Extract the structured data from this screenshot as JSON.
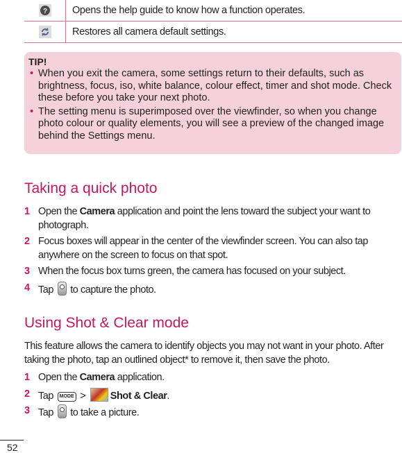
{
  "icon_table": [
    {
      "icon": "help-icon",
      "glyph": "?",
      "text": "Opens the help guide to know how a function operates."
    },
    {
      "icon": "reset-icon",
      "glyph": "⟳",
      "text": "Restores all camera default settings."
    }
  ],
  "tip": {
    "title": "TIP!",
    "bullet": "•",
    "items": [
      "When you exit the camera, some settings return to their defaults, such as brightness, focus, iso, white balance, colour effect, timer and shot mode. Check these before you take your next photo.",
      "The setting menu is superimposed over the viewfinder, so when you change photo colour or quality elements, you will see a preview of the changed image behind the Settings menu."
    ]
  },
  "quick_photo": {
    "heading": "Taking a quick photo",
    "steps": [
      {
        "num": "1",
        "pre": "Open the ",
        "bold": "Camera",
        "post": " application and point the lens toward the subject your want to photograph."
      },
      {
        "num": "2",
        "text": "Focus boxes will appear in the center of the viewfinder screen. You can also tap anywhere on the screen to focus on that spot."
      },
      {
        "num": "3",
        "text": "When the focus box turns green, the camera has focused on your subject."
      },
      {
        "num": "4",
        "pre": "Tap ",
        "icon": "shutter-icon",
        "post": " to capture the photo."
      }
    ]
  },
  "shot_clear": {
    "heading": "Using Shot & Clear mode",
    "intro": "This feature allows the camera to identify objects you may not want in your photo. After taking the photo, tap an outlined object* to remove it, then save the photo.",
    "steps": [
      {
        "num": "1",
        "pre": "Open the ",
        "bold": "Camera",
        "post": " application."
      },
      {
        "num": "2",
        "pre": "Tap ",
        "mode_label": "MODE",
        "sep": " > ",
        "bold": "Shot & Clear",
        "post": "."
      },
      {
        "num": "3",
        "pre": "Tap ",
        "icon": "shutter-icon",
        "post": " to take a picture."
      }
    ]
  },
  "page_number": "52",
  "colors": {
    "accent": "#c8175d",
    "tip_bg": "#f5d1db",
    "rule": "#d9738f"
  }
}
